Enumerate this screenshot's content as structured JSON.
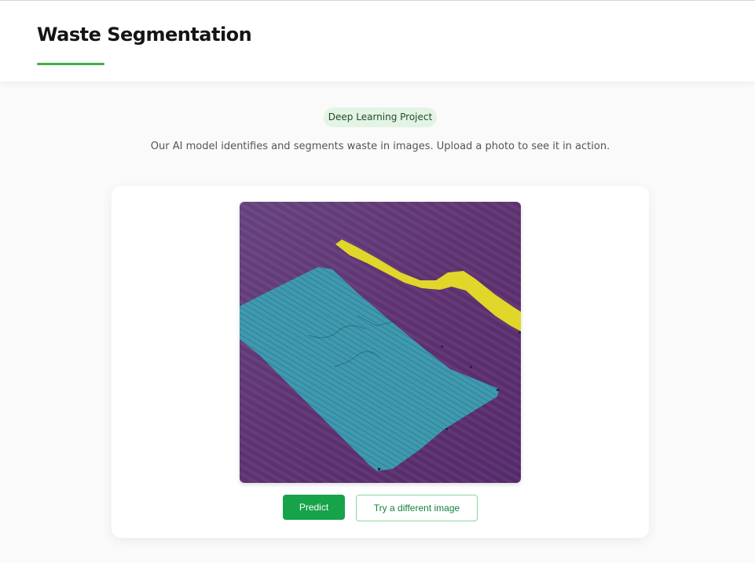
{
  "header": {
    "title": "Waste Segmentation"
  },
  "intro": {
    "badge": "Deep Learning Project",
    "description": "Our AI model identifies and segments waste in images. Upload a photo to see it in action."
  },
  "preview": {
    "alt": "Segmented waste prediction",
    "colors": {
      "background_class": "#5c2f72",
      "carton_class": "#3f9ab0",
      "strip_class": "#e1d62a"
    }
  },
  "actions": {
    "predict_label": "Predict",
    "retry_label": "Try a different image"
  }
}
